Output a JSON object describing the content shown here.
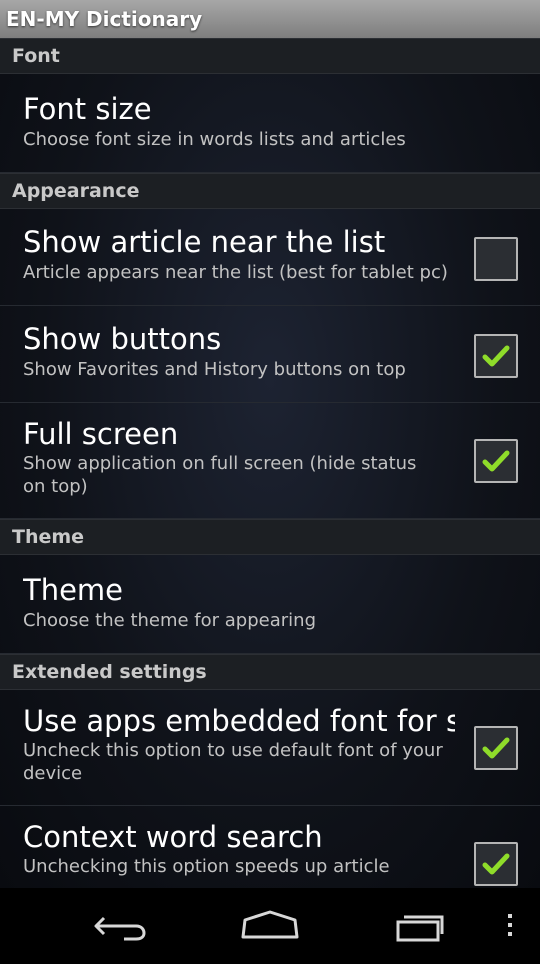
{
  "app": {
    "title": "EN-MY Dictionary"
  },
  "sections": {
    "font": "Font",
    "appearance": "Appearance",
    "theme": "Theme",
    "extended": "Extended settings"
  },
  "items": {
    "font_size": {
      "title": "Font size",
      "summary": "Choose font size in words lists and articles"
    },
    "show_article": {
      "title": "Show article near the list",
      "summary": "Article appears near the list (best for tablet pc)",
      "checked": false
    },
    "show_buttons": {
      "title": "Show buttons",
      "summary": "Show Favorites and History buttons on top",
      "checked": true
    },
    "full_screen": {
      "title": "Full screen",
      "summary": "Show application on full screen (hide status on top)",
      "checked": true
    },
    "theme": {
      "title": "Theme",
      "summary": "Choose the theme for appearing"
    },
    "embedded_font": {
      "title": "Use apps embedded font for s",
      "summary": "Uncheck this option to use default font of your device",
      "checked": true
    },
    "context_search": {
      "title": "Context word search",
      "summary": "Unchecking this option speeds up article",
      "checked": true
    }
  },
  "colors": {
    "title_bar": "#8f8f8f",
    "section_bg": "#1c1f23",
    "check_mark": "#8fdc2a"
  },
  "icons": {
    "back": "back-arrow-icon",
    "home": "home-icon",
    "recents": "recent-apps-icon",
    "menu": "overflow-menu-icon"
  }
}
